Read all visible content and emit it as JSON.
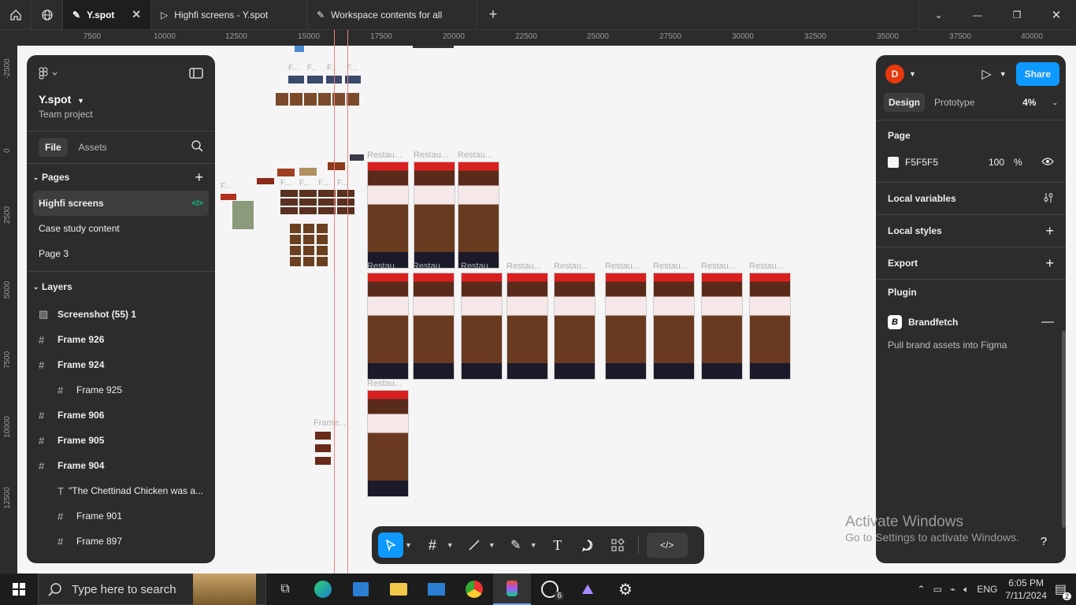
{
  "tabs": [
    {
      "label": "Y.spot",
      "active": true
    },
    {
      "label": "Highfi screens - Y.spot",
      "active": false
    },
    {
      "label": "Workspace contents for all",
      "active": false
    }
  ],
  "ruler_top": [
    "7500",
    "10000",
    "12500",
    "15000",
    "17500",
    "20000",
    "22500",
    "25000",
    "27500",
    "30000",
    "32500",
    "35000",
    "37500",
    "40000"
  ],
  "ruler_left": [
    "-2500",
    "0",
    "2500",
    "5000",
    "7500",
    "10000",
    "12500"
  ],
  "left_panel": {
    "file_name": "Y.spot",
    "subtitle": "Team project",
    "tab_file": "File",
    "tab_assets": "Assets",
    "pages_title": "Pages",
    "pages": [
      "Highfi screens",
      "Case study content",
      "Page 3"
    ],
    "layers_title": "Layers",
    "layers": [
      {
        "label": "Screenshot (55) 1",
        "icon": "image-icon",
        "indent": 0
      },
      {
        "label": "Frame 926",
        "icon": "frame-icon",
        "indent": 0
      },
      {
        "label": "Frame 924",
        "icon": "frame-icon",
        "indent": 0
      },
      {
        "label": "Frame 925",
        "icon": "frame-icon",
        "indent": 1
      },
      {
        "label": "Frame 906",
        "icon": "frame-icon",
        "indent": 0
      },
      {
        "label": "Frame 905",
        "icon": "frame-icon",
        "indent": 0
      },
      {
        "label": "Frame 904",
        "icon": "frame-icon",
        "indent": 0
      },
      {
        "label": "\"The Chettinad Chicken was a...",
        "icon": "text-icon",
        "indent": 1
      },
      {
        "label": "Frame 901",
        "icon": "frame-icon",
        "indent": 1
      },
      {
        "label": "Frame 897",
        "icon": "frame-icon",
        "indent": 1
      }
    ]
  },
  "right_panel": {
    "avatar_letter": "D",
    "share_label": "Share",
    "tab_design": "Design",
    "tab_prototype": "Prototype",
    "zoom": "4%",
    "page_title": "Page",
    "page_color": "F5F5F5",
    "page_opacity": "100",
    "opacity_unit": "%",
    "local_variables": "Local variables",
    "local_styles": "Local styles",
    "export": "Export",
    "plugin_title": "Plugin",
    "plugin_name": "Brandfetch",
    "plugin_desc": "Pull brand assets into Figma"
  },
  "canvas": {
    "frame_labels": [
      "Restau...",
      "Frame...",
      "F..."
    ]
  },
  "watermark": {
    "line1": "Activate Windows",
    "line2": "Go to Settings to activate Windows."
  },
  "taskbar": {
    "search_placeholder": "Type here to search",
    "language": "ENG",
    "time": "6:05 PM",
    "date": "7/11/2024",
    "whatsapp_badge": "6",
    "notif_badge": "2"
  },
  "colors": {
    "accent": "#0d99ff",
    "panel": "#2c2c2c",
    "avatar": "#e8380d",
    "canvas": "#F5F5F5"
  }
}
